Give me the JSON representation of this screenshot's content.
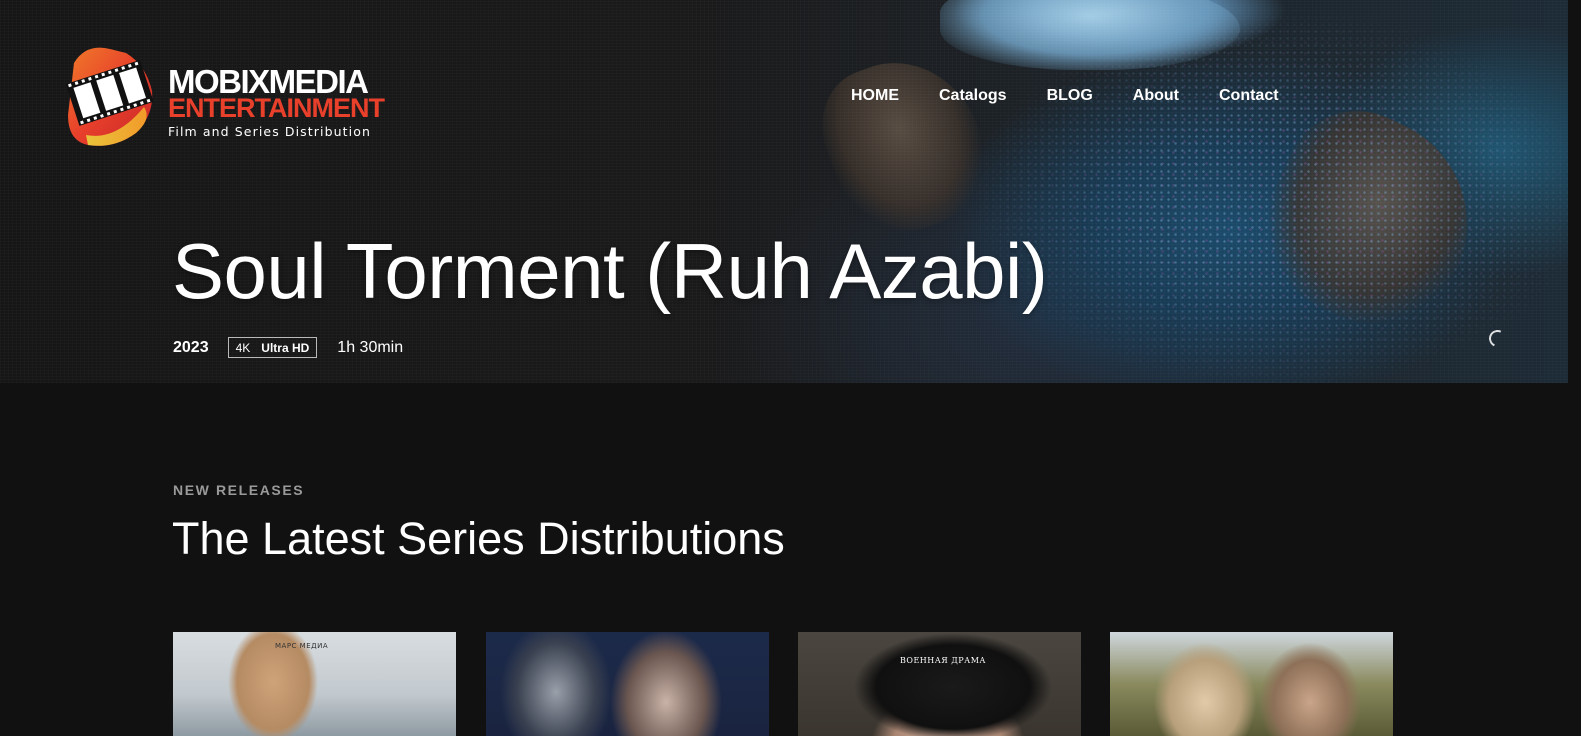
{
  "brand": {
    "name_line1": "MOBIXMEDIA",
    "name_line2": "ENTERTAINMENT",
    "tagline": "Film and Series Distribution",
    "colors": {
      "accent_red": "#e8402b",
      "accent_orange": "#f2912a",
      "accent_yellow": "#e9c53a"
    }
  },
  "nav": {
    "items": [
      {
        "label": "HOME"
      },
      {
        "label": "Catalogs"
      },
      {
        "label": "BLOG"
      },
      {
        "label": "About"
      },
      {
        "label": "Contact"
      }
    ]
  },
  "hero": {
    "title": "Soul Torment (Ruh Azabi)",
    "year": "2023",
    "badge_resolution": "4K",
    "badge_quality": "Ultra HD",
    "duration": "1h 30min",
    "loading_icon": "spinner-icon"
  },
  "section": {
    "kicker": "NEW RELEASES",
    "title": "The Latest Series Distributions"
  },
  "cards": [
    {
      "poster_text": "МАРС МЕДИА"
    },
    {
      "poster_text": ""
    },
    {
      "poster_text": "ВОЕННАЯ ДРАМА"
    },
    {
      "poster_text": ""
    }
  ]
}
